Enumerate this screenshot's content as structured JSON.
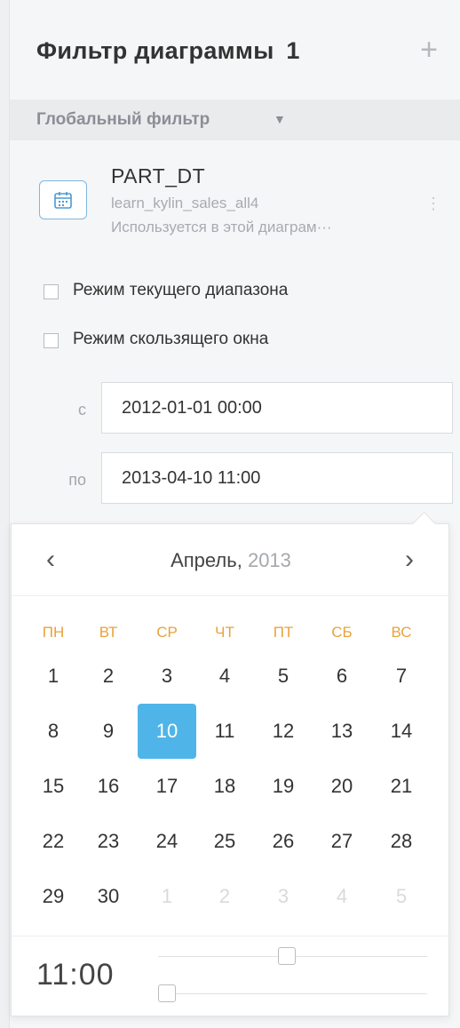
{
  "panel": {
    "title": "Фильтр диаграммы",
    "count": "1",
    "add_icon": "plus-icon"
  },
  "section": {
    "label": "Глобальный фильтр",
    "caret_icon": "caret-down-icon"
  },
  "field": {
    "icon": "calendar-icon",
    "name": "PART_DT",
    "table": "learn_kylin_sales_all4",
    "usage": "Используется в этой диаграм···",
    "more_icon": "more-vertical-icon"
  },
  "modes": [
    {
      "label": "Режим текущего диапазона",
      "checked": false
    },
    {
      "label": "Режим скользящего окна",
      "checked": false
    }
  ],
  "range": {
    "from_label": "с",
    "from_value": "2012-01-01 00:00",
    "to_label": "по",
    "to_value": "2013-04-10 11:00"
  },
  "picker": {
    "prev_icon": "chevron-left-icon",
    "next_icon": "chevron-right-icon",
    "month": "Апрель,",
    "year": "2013",
    "weekdays": [
      "ПН",
      "ВТ",
      "СР",
      "ЧТ",
      "ПТ",
      "СБ",
      "ВС"
    ],
    "weeks": [
      [
        1,
        2,
        3,
        4,
        5,
        6,
        7
      ],
      [
        8,
        9,
        10,
        11,
        12,
        13,
        14
      ],
      [
        15,
        16,
        17,
        18,
        19,
        20,
        21
      ],
      [
        22,
        23,
        24,
        25,
        26,
        27,
        28
      ],
      [
        29,
        30,
        1,
        2,
        3,
        4,
        5
      ]
    ],
    "other_month_from_index": 30,
    "selected_day": 10,
    "time": "11:00",
    "hour_value": 11,
    "hour_max": 23,
    "minute_value": 0,
    "minute_max": 59
  },
  "colors": {
    "accent": "#4fb5e8",
    "weekday": "#e8a33b",
    "muted_text": "#a7abb0"
  }
}
